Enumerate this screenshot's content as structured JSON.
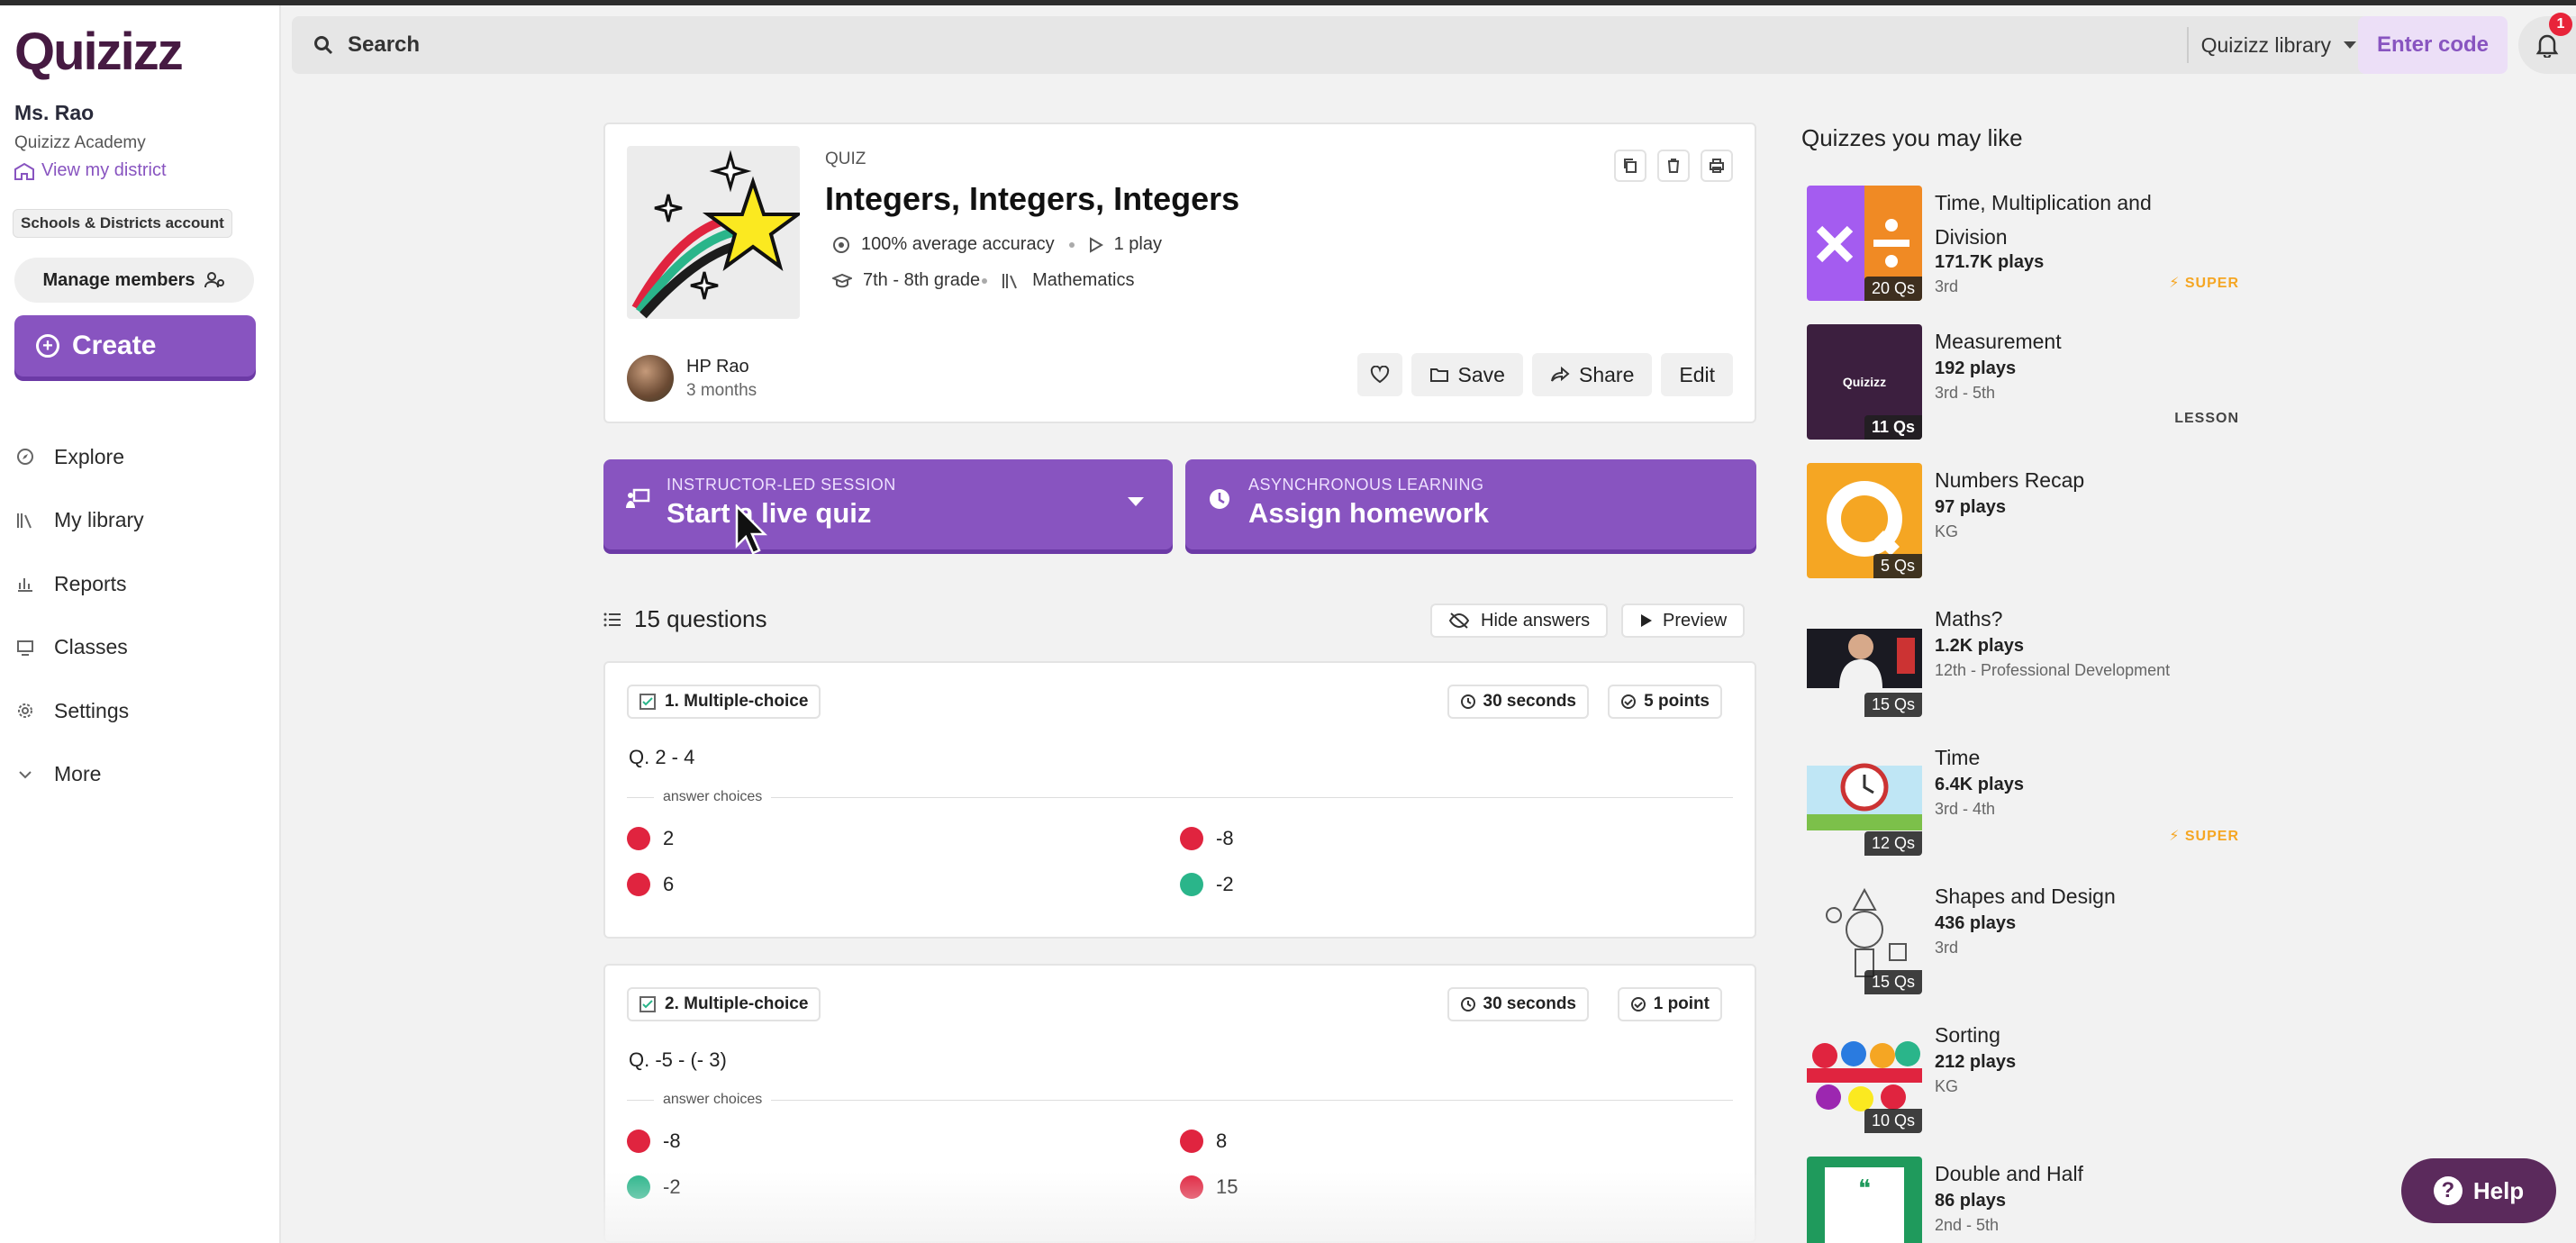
{
  "app": {
    "logo_text": "Quizizz"
  },
  "sidebar": {
    "teacher_name": "Ms. Rao",
    "school": "Quizizz Academy",
    "district_link": "View my district",
    "account_badge": "Schools & Districts account",
    "manage_members": "Manage members",
    "create_label": "Create",
    "nav": [
      {
        "label": "Explore",
        "icon": "compass-icon"
      },
      {
        "label": "My library",
        "icon": "books-icon"
      },
      {
        "label": "Reports",
        "icon": "bar-chart-icon"
      },
      {
        "label": "Classes",
        "icon": "classroom-icon"
      },
      {
        "label": "Settings",
        "icon": "gear-icon"
      },
      {
        "label": "More",
        "icon": "chevron-down-icon"
      }
    ]
  },
  "search": {
    "placeholder": "Search",
    "library_select": "Quizizz library",
    "enter_code": "Enter code",
    "notification_count": "1"
  },
  "quiz": {
    "type": "QUIZ",
    "title": "Integers, Integers, Integers",
    "accuracy": "100% average accuracy",
    "plays": "1 play",
    "grade": "7th - 8th grade",
    "subject": "Mathematics",
    "author": "HP Rao",
    "author_time": "3 months",
    "actions": {
      "save": "Save",
      "share": "Share",
      "edit": "Edit"
    }
  },
  "live": {
    "small": "INSTRUCTOR-LED SESSION",
    "big": "Start a live quiz"
  },
  "homework": {
    "small": "ASYNCHRONOUS LEARNING",
    "big": "Assign homework"
  },
  "questions": {
    "count_label": "15 questions",
    "hide_answers": "Hide answers",
    "preview": "Preview",
    "answer_choices_label": "answer choices",
    "items": [
      {
        "type": "1. Multiple-choice",
        "time": "30 seconds",
        "points": "5 points",
        "question": "Q. 2 - 4",
        "choices": [
          {
            "text": "2",
            "correct": false
          },
          {
            "text": "-8",
            "correct": false
          },
          {
            "text": "6",
            "correct": false
          },
          {
            "text": "-2",
            "correct": true
          }
        ]
      },
      {
        "type": "2. Multiple-choice",
        "time": "30 seconds",
        "points": "1 point",
        "question": "Q. -5 - (- 3)",
        "choices": [
          {
            "text": "-8",
            "correct": false
          },
          {
            "text": "8",
            "correct": false
          },
          {
            "text": "-2",
            "correct": true
          },
          {
            "text": "15",
            "correct": false
          }
        ]
      }
    ]
  },
  "recommendations": {
    "title": "Quizzes you may like",
    "items": [
      {
        "name": "Time, Multiplication and Division",
        "plays": "171.7K plays",
        "grade": "3rd",
        "qs": "20 Qs",
        "tag": "SUPER"
      },
      {
        "name": "Measurement",
        "plays": "192 plays",
        "grade": "3rd - 5th",
        "qs": "11 Qs",
        "tag": "LESSON",
        "thumb_text": "Quizizz"
      },
      {
        "name": "Numbers Recap",
        "plays": "97 plays",
        "grade": "KG",
        "qs": "5 Qs",
        "tag": ""
      },
      {
        "name": "Maths?",
        "plays": "1.2K plays",
        "grade": "12th - Professional Development",
        "qs": "15 Qs",
        "tag": ""
      },
      {
        "name": "Time",
        "plays": "6.4K plays",
        "grade": "3rd - 4th",
        "qs": "12 Qs",
        "tag": "SUPER"
      },
      {
        "name": "Shapes and Design",
        "plays": "436 plays",
        "grade": "3rd",
        "qs": "15 Qs",
        "tag": ""
      },
      {
        "name": "Sorting",
        "plays": "212 plays",
        "grade": "KG",
        "qs": "10 Qs",
        "tag": ""
      },
      {
        "name": "Double and Half",
        "plays": "86 plays",
        "grade": "2nd - 5th",
        "qs": "",
        "tag": ""
      }
    ]
  },
  "help": {
    "label": "Help"
  },
  "colors": {
    "brand_purple": "#8854c0",
    "logo": "#461a42",
    "correct": "#2ab58a",
    "incorrect": "#e0243f",
    "super": "#f5a623"
  }
}
